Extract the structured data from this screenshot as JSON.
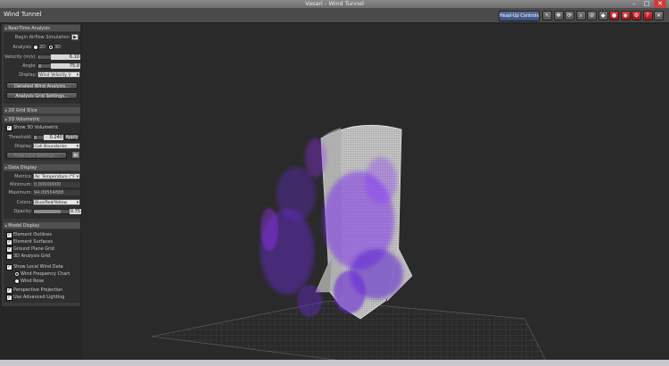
{
  "window": {
    "title": "Vasari - Wind Tunnel",
    "minimize": "–",
    "maximize": "□",
    "close": "✕"
  },
  "toolbar": {
    "app_name": "Wind Tunnel",
    "hud_label": "Head-Up Controls",
    "icons": [
      {
        "name": "select-icon",
        "glyph": "↖"
      },
      {
        "name": "pan-icon",
        "glyph": "✥"
      },
      {
        "name": "orbit-icon",
        "glyph": "⟳"
      },
      {
        "name": "zoom-icon",
        "glyph": "⌕"
      },
      {
        "name": "section-icon",
        "glyph": "⊘"
      },
      {
        "name": "view-cube-icon",
        "glyph": "◆"
      },
      {
        "name": "record-icon",
        "glyph": "●"
      },
      {
        "name": "camera-icon",
        "glyph": "◉"
      },
      {
        "name": "settings-icon",
        "glyph": "⚙"
      },
      {
        "name": "help-icon",
        "glyph": "?"
      },
      {
        "name": "close-panel-icon",
        "glyph": "✕"
      }
    ],
    "red_icon_indices": [
      6,
      7,
      8,
      9
    ]
  },
  "realtime": {
    "header": "Real-Time Analysis",
    "begin_label": "Begin Airflow Simulation",
    "analysis_label": "Analysis",
    "opt_2d": "2D",
    "opt_3d": "3D",
    "analysis_mode": "3D",
    "velocity_label": "Velocity (m/s):",
    "velocity_value": "6.10",
    "velocity_fraction": 0.1,
    "angle_label": "Angle:",
    "angle_value": "75.0",
    "angle_fraction": 0.2,
    "display_label": "Display:",
    "display_value": "Wind Velocity (r",
    "detailed_button": "Detailed Wind Analysis...",
    "grid_button": "Analysis Grid Settings..."
  },
  "grid_slice": {
    "header": "2D Grid Slice"
  },
  "volumetric": {
    "header": "3D Volumetric",
    "show_label": "Show 3D Volumetric",
    "show_checked": true,
    "threshold_label": "Threshold:",
    "threshold_value": "0.240",
    "threshold_fraction": 0.24,
    "apply_button": "Apply",
    "display_label": "Display:",
    "display_value": "Cell Boundaries",
    "flow_button": "Flow Line Settings..."
  },
  "data_display": {
    "header": "Data Display",
    "metrics_label": "Metrics:",
    "metrics_value": "Air Temperature (°F",
    "minimum_label": "Minimum:",
    "minimum_value": "0.00000000",
    "maximum_label": "Maximum:",
    "maximum_value": "94.09554888",
    "colors_label": "Colors:",
    "colors_value": "Blue/Red/Yellow",
    "opacity_label": "Opacity:",
    "opacity_value": "0.75",
    "opacity_fraction": 0.75
  },
  "model_display": {
    "header": "Model Display",
    "element_outlines": "Element Outlines",
    "element_surfaces": "Element Surfaces",
    "ground_plane_grid": "Ground Plane Grid",
    "analysis_grid_3d": "3D Analysis Grid",
    "show_local_wind": "Show Local Wind Data",
    "wind_frequency": "Wind Frequency Chart",
    "wind_rose": "Wind Rose",
    "perspective": "Perspective Projection",
    "advanced_lighting": "Use Advanced Lighting",
    "checks": {
      "element_outlines": true,
      "element_surfaces": true,
      "ground_plane_grid": true,
      "analysis_grid_3d": false,
      "show_local_wind": true,
      "perspective": true,
      "advanced_lighting": true
    },
    "wind_chart_mode": "Wind Frequency Chart"
  },
  "colors": {
    "flow_purple": "#6a2bd8",
    "flow_violet": "#9b30ff",
    "panel_bg": "#3a3a3a",
    "viewport_bg": "#2a2a2a"
  }
}
